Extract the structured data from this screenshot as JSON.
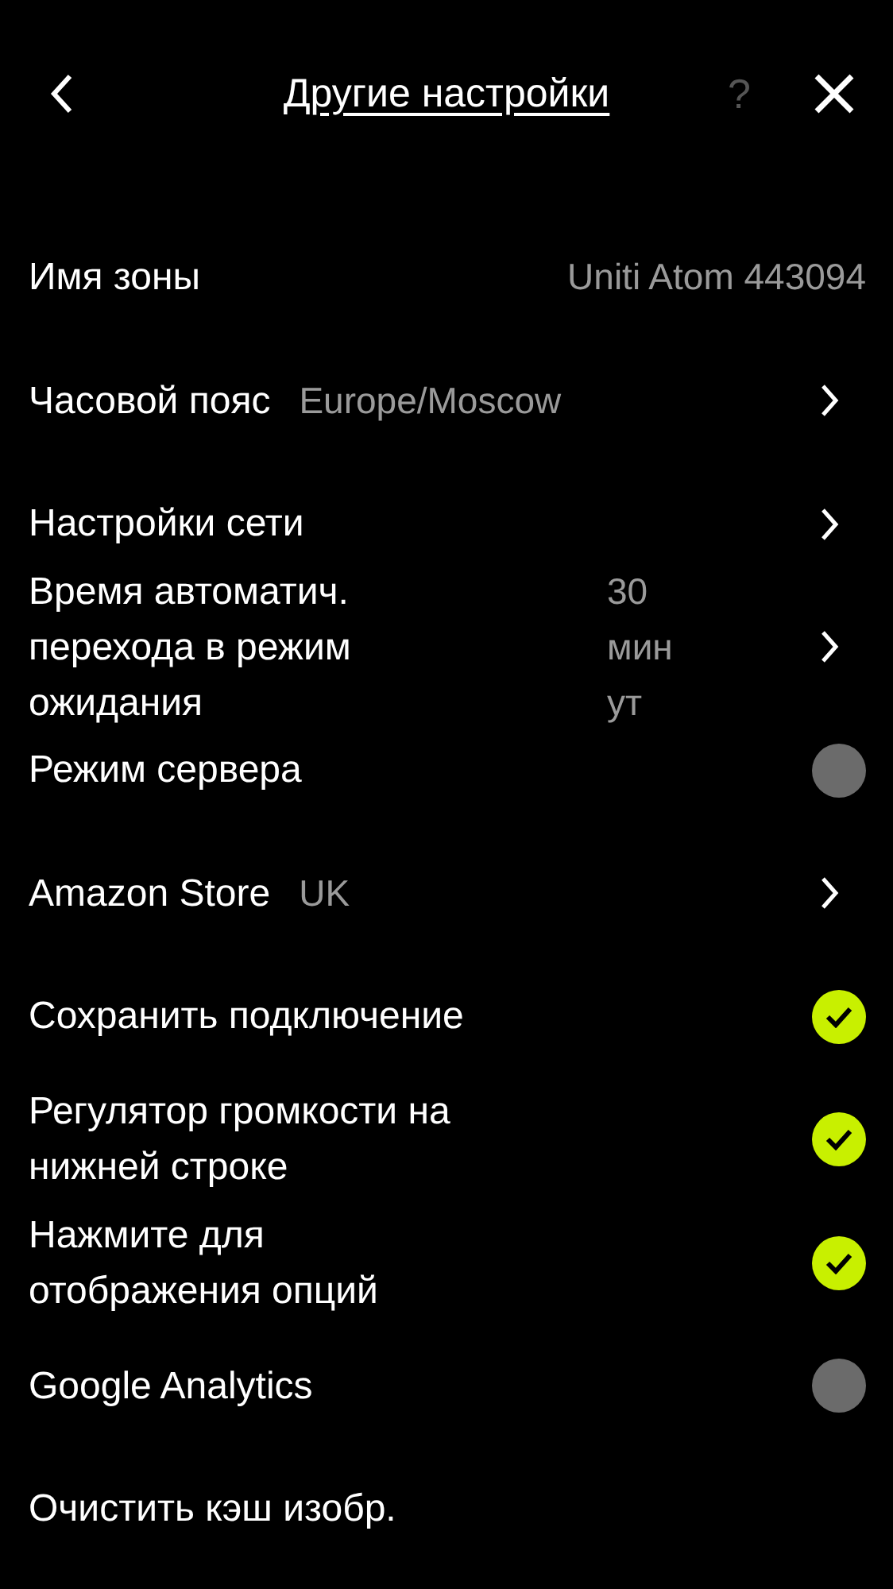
{
  "header": {
    "title": "Другие настройки",
    "help": "?"
  },
  "rows": [
    {
      "kind": "info",
      "label": "Имя зоны",
      "value": "Uniti Atom 443094"
    },
    {
      "kind": "nav",
      "label": "Часовой пояс",
      "value": "Europe/Moscow"
    },
    {
      "kind": "nav",
      "label": "Настройки сети"
    },
    {
      "kind": "nav",
      "label": "Время автоматич. перехода в режим ожидания",
      "value": "30 минут"
    },
    {
      "kind": "toggle",
      "label": "Режим сервера",
      "checked": false
    },
    {
      "kind": "nav",
      "label": "Amazon Store",
      "value": "UK"
    },
    {
      "kind": "toggle",
      "label": "Сохранить подключение",
      "checked": true
    },
    {
      "kind": "toggle",
      "label": "Регулятор громкости на нижней строке",
      "checked": true
    },
    {
      "kind": "toggle",
      "label": "Нажмите для отображения опций",
      "checked": true
    },
    {
      "kind": "toggle",
      "label": "Google Analytics",
      "checked": false
    },
    {
      "kind": "action",
      "label": "Очистить кэш изобр."
    }
  ]
}
